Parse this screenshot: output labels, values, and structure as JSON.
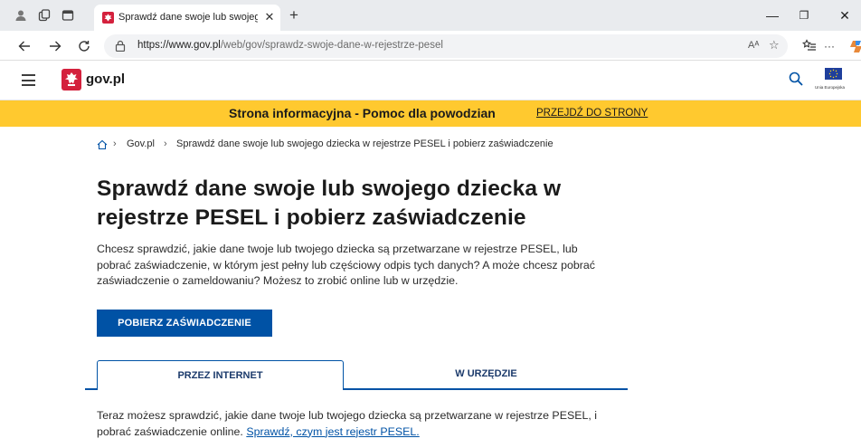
{
  "browser": {
    "tab_title": "Sprawdź dane swoje lub swojego dziecka",
    "url_host": "https://www.gov.pl",
    "url_path": "/web/gov/sprawdz-swoje-dane-w-rejestrze-pesel",
    "read_aloud": "Aᴬ"
  },
  "header": {
    "logo_text": "gov.pl",
    "eu_label": "Unia Europejska"
  },
  "infobar": {
    "text": "Strona informacyjna - Pomoc dla powodzian",
    "link": "PRZEJDŹ DO STRONY"
  },
  "breadcrumb": {
    "items": [
      "Gov.pl",
      "Sprawdź dane swoje lub swojego dziecka w rejestrze PESEL i pobierz zaświadczenie"
    ]
  },
  "main": {
    "title": "Sprawdź dane swoje lub swojego dziecka w rejestrze PESEL i pobierz zaświadczenie",
    "intro": "Chcesz sprawdzić, jakie dane twoje lub twojego dziecka są przetwarzane w rejestrze PESEL, lub pobrać zaświadczenie, w którym jest pełny lub częściowy odpis tych danych? A może chcesz pobrać zaświadczenie o zameldowaniu? Możesz to zrobić online lub w urzędzie.",
    "cta_label": "POBIERZ ZAŚWIADCZENIE",
    "tabs": [
      {
        "label": "PRZEZ INTERNET",
        "active": true
      },
      {
        "label": "W URZĘDZIE",
        "active": false
      }
    ],
    "tab_text": "Teraz możesz sprawdzić, jakie dane twoje lub twojego dziecka są przetwarzane w rejestrze PESEL, i pobrać zaświadczenie online.",
    "tab_link": "Sprawdź, czym jest rejestr PESEL."
  },
  "colors": {
    "accent": "#0052a5",
    "infobar": "#ffc92f",
    "brand_red": "#d4213d"
  }
}
